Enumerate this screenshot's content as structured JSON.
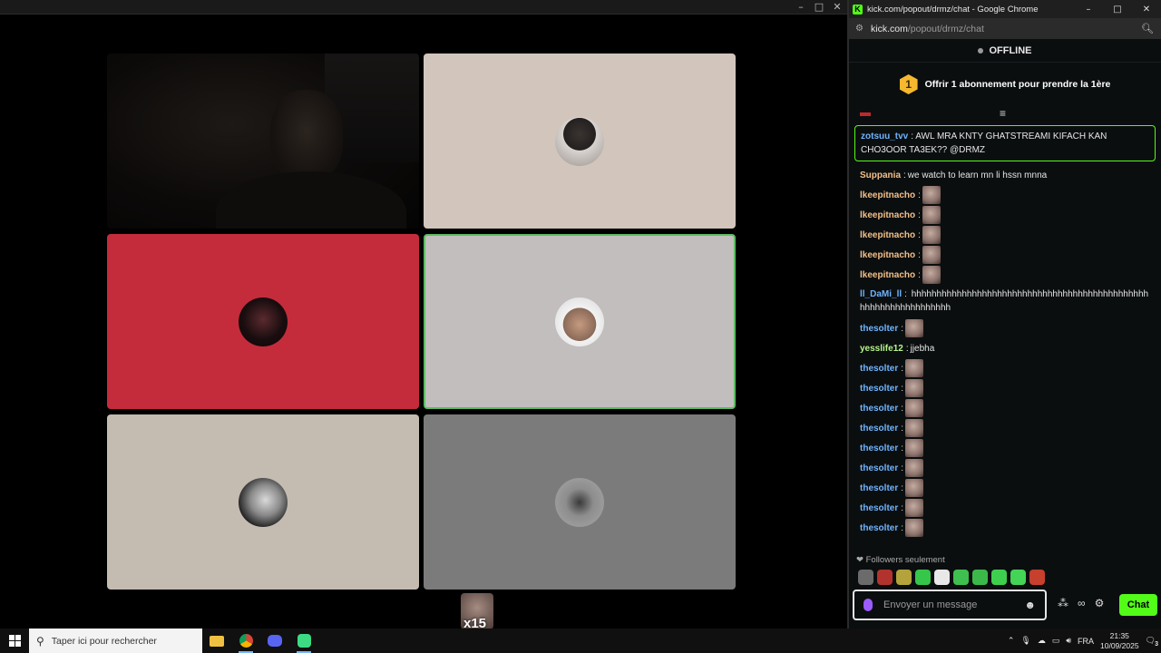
{
  "call": {
    "badge_count": "x15",
    "tiles": [
      {
        "name": "tile-camera",
        "bg": "#0c0a09"
      },
      {
        "name": "tile-user-2",
        "bg": "#d2c5bc"
      },
      {
        "name": "tile-user-3",
        "bg": "#c42c3c"
      },
      {
        "name": "tile-user-4",
        "bg": "#c2bebd"
      },
      {
        "name": "tile-user-5",
        "bg": "#c4bcb1"
      },
      {
        "name": "tile-user-6",
        "bg": "#7b7b7b"
      }
    ]
  },
  "chrome": {
    "window_title": "kick.com/popout/drmz/chat - Google Chrome",
    "url_host": "kick.com",
    "url_path": "/popout/drmz/chat"
  },
  "chat": {
    "status": "OFFLINE",
    "sub_badge": "1",
    "sub_text": "Offrir 1 abonnement pour prendre la 1ère",
    "highlighted": {
      "user": "zotsuu_tvv",
      "color": "#6fb4ff",
      "text": "AWL MRA KNTY GHATSTREAMI KIFACH KAN CHO3OOR TA3EK?? @DRMZ"
    },
    "messages": [
      {
        "user": "Suppania",
        "color": "#f3c08a",
        "text": "we watch to learn mn li hssn mnna",
        "emote": false
      },
      {
        "user": "lkeepitnacho",
        "color": "#f3c08a",
        "text": "",
        "emote": true
      },
      {
        "user": "lkeepitnacho",
        "color": "#f3c08a",
        "text": "",
        "emote": true
      },
      {
        "user": "lkeepitnacho",
        "color": "#f3c08a",
        "text": "",
        "emote": true
      },
      {
        "user": "lkeepitnacho",
        "color": "#f3c08a",
        "text": "",
        "emote": true
      },
      {
        "user": "lkeepitnacho",
        "color": "#f3c08a",
        "text": "",
        "emote": true
      },
      {
        "user": "ll_DaMi_ll",
        "color": "#6fb4ff",
        "text": "hhhhhhhhhhhhhhhhhhhhhhhhhhhhhhhhhhhhhhhhhhhhhhhhhhhhhhhhhhhhhhhhh",
        "emote": false,
        "tall": true
      },
      {
        "user": "thesolter",
        "color": "#6fb4ff",
        "text": "",
        "emote": true
      },
      {
        "user": "yesslife12",
        "color": "#b7f58a",
        "text": "jjebha",
        "emote": false
      },
      {
        "user": "thesolter",
        "color": "#6fb4ff",
        "text": "",
        "emote": true
      },
      {
        "user": "thesolter",
        "color": "#6fb4ff",
        "text": "",
        "emote": true
      },
      {
        "user": "thesolter",
        "color": "#6fb4ff",
        "text": "",
        "emote": true
      },
      {
        "user": "thesolter",
        "color": "#6fb4ff",
        "text": "",
        "emote": true
      },
      {
        "user": "thesolter",
        "color": "#6fb4ff",
        "text": "",
        "emote": true
      },
      {
        "user": "thesolter",
        "color": "#6fb4ff",
        "text": "",
        "emote": true
      },
      {
        "user": "thesolter",
        "color": "#6fb4ff",
        "text": "",
        "emote": true
      },
      {
        "user": "thesolter",
        "color": "#6fb4ff",
        "text": "",
        "emote": true
      },
      {
        "user": "thesolter",
        "color": "#6fb4ff",
        "text": "",
        "emote": true
      }
    ],
    "followers_only": "Followers seulement",
    "quick_emotes": [
      "#6b6b6b",
      "#b2332e",
      "#b4a23c",
      "#35c64a",
      "#e8e8e8",
      "#3fbf4f",
      "#3cb84a",
      "#3fcf4f",
      "#44d456",
      "#c6402d"
    ],
    "input_placeholder": "Envoyer un message",
    "send_label": "Chat"
  },
  "taskbar": {
    "search_placeholder": "Taper ici pour rechercher",
    "lang": "FRA",
    "time": "21:35",
    "date": "10/09/2025",
    "notif_count": "3"
  }
}
